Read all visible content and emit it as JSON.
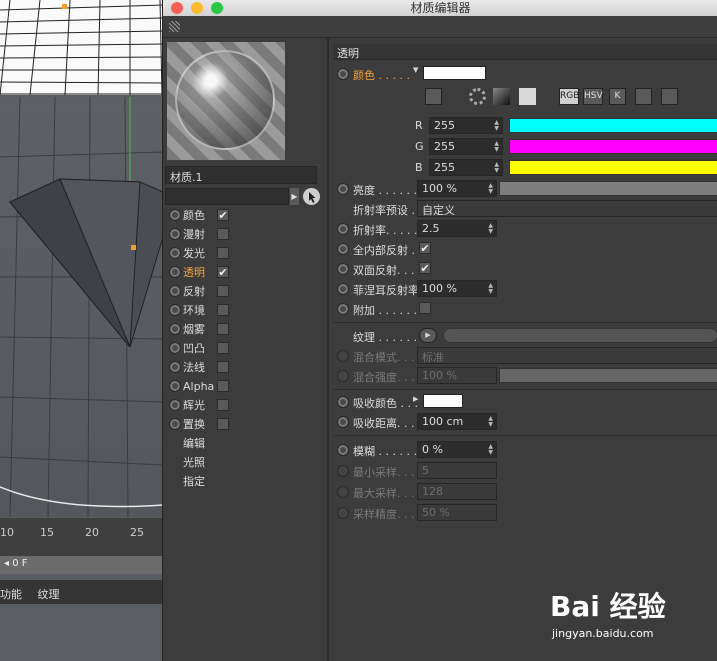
{
  "window": {
    "title": "材质编辑器"
  },
  "material": {
    "name": "材质.1"
  },
  "channels": [
    {
      "label": "颜色",
      "checked": true,
      "selected": false
    },
    {
      "label": "漫射",
      "checked": false,
      "selected": false
    },
    {
      "label": "发光",
      "checked": false,
      "selected": false
    },
    {
      "label": "透明",
      "checked": true,
      "selected": true
    },
    {
      "label": "反射",
      "checked": false,
      "selected": false
    },
    {
      "label": "环境",
      "checked": false,
      "selected": false
    },
    {
      "label": "烟雾",
      "checked": false,
      "selected": false
    },
    {
      "label": "凹凸",
      "checked": false,
      "selected": false
    },
    {
      "label": "法线",
      "checked": false,
      "selected": false
    },
    {
      "label": "Alpha",
      "checked": false,
      "selected": false
    },
    {
      "label": "辉光",
      "checked": false,
      "selected": false
    },
    {
      "label": "置换",
      "checked": false,
      "selected": false
    }
  ],
  "extra_items": [
    "编辑",
    "光照",
    "指定"
  ],
  "panel": {
    "section": "透明",
    "color_label": "颜色 . . . . .",
    "modes": [
      "RGB",
      "HSV",
      "K"
    ],
    "r": {
      "label": "R",
      "value": "255",
      "color": "#00ffff"
    },
    "g": {
      "label": "G",
      "value": "255",
      "color": "#ff00ff"
    },
    "b": {
      "label": "B",
      "value": "255",
      "color": "#ffff00"
    },
    "brightness": {
      "label": "亮度 . . . . . . .",
      "value": "100 %"
    },
    "ior_preset": {
      "label": "折射率预设 . .",
      "value": "自定义"
    },
    "ior": {
      "label": "折射率. . . . . .",
      "value": "2.5"
    },
    "total_internal": {
      "label": "全内部反射 . . .",
      "checked": true
    },
    "double_sided": {
      "label": "双面反射. . . .",
      "checked": true
    },
    "fresnel": {
      "label": "菲涅耳反射率",
      "value": "100 %"
    },
    "additive": {
      "label": "附加 . . . . . . .",
      "checked": false
    },
    "texture": {
      "label": "纹理 . . . . . . ."
    },
    "blend_mode": {
      "label": "混合模式. . . .",
      "value": "标准"
    },
    "blend_strength": {
      "label": "混合强度. . . .",
      "value": "100 %"
    },
    "absorb_color": {
      "label": "吸收颜色 . . ."
    },
    "absorb_distance": {
      "label": "吸收距离. . . .",
      "value": "100 cm"
    },
    "blur": {
      "label": "模糊 . . . . . . .",
      "value": "0 %"
    },
    "min_samples": {
      "label": "最小采样. . . .",
      "value": "5"
    },
    "max_samples": {
      "label": "最大采样. . . .",
      "value": "128"
    },
    "accuracy": {
      "label": "采样精度. . . .",
      "value": "50 %"
    }
  },
  "viewport": {
    "ruler": [
      "10",
      "15",
      "20",
      "25"
    ],
    "time": "0 F",
    "menu": [
      "功能",
      "纹理"
    ]
  },
  "watermark": {
    "logo": "Bai 经验",
    "url": "jingyan.baidu.com"
  }
}
